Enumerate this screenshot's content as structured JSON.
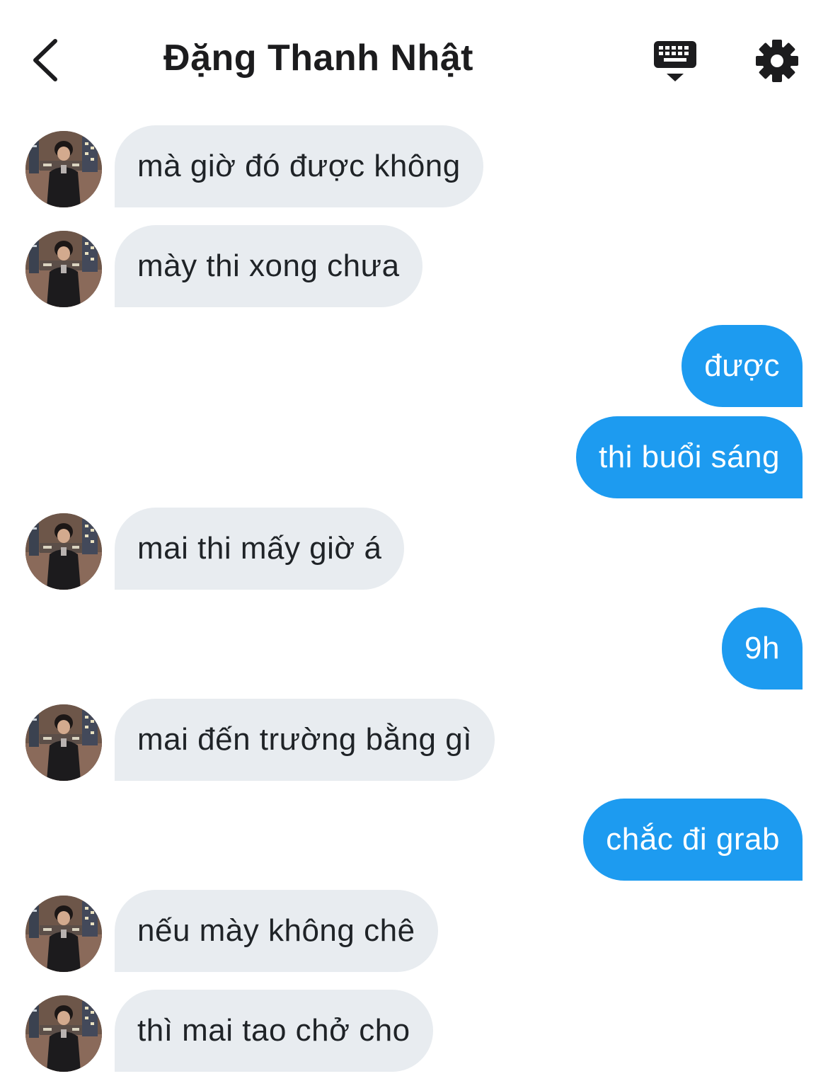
{
  "header": {
    "back_icon": "chevron-left-icon",
    "title": "Đặng Thanh Nhật",
    "keyboard_icon": "keyboard-icon",
    "settings_icon": "gear-icon"
  },
  "colors": {
    "incoming_bubble": "#e8ecf0",
    "outgoing_bubble": "#1d9bf0",
    "incoming_text": "#1f2327",
    "outgoing_text": "#ffffff"
  },
  "messages": [
    {
      "direction": "in",
      "text": "mà giờ đó được không"
    },
    {
      "direction": "in",
      "text": "mày thi xong chưa"
    },
    {
      "direction": "out",
      "text": "được"
    },
    {
      "direction": "out",
      "text": "thi buổi sáng"
    },
    {
      "direction": "in",
      "text": "mai thi mấy giờ á"
    },
    {
      "direction": "out",
      "text": "9h"
    },
    {
      "direction": "in",
      "text": "mai đến trường bằng gì"
    },
    {
      "direction": "out",
      "text": "chắc đi grab"
    },
    {
      "direction": "in",
      "text": "nếu mày không chê"
    },
    {
      "direction": "in",
      "text": "thì mai tao chở cho"
    }
  ]
}
